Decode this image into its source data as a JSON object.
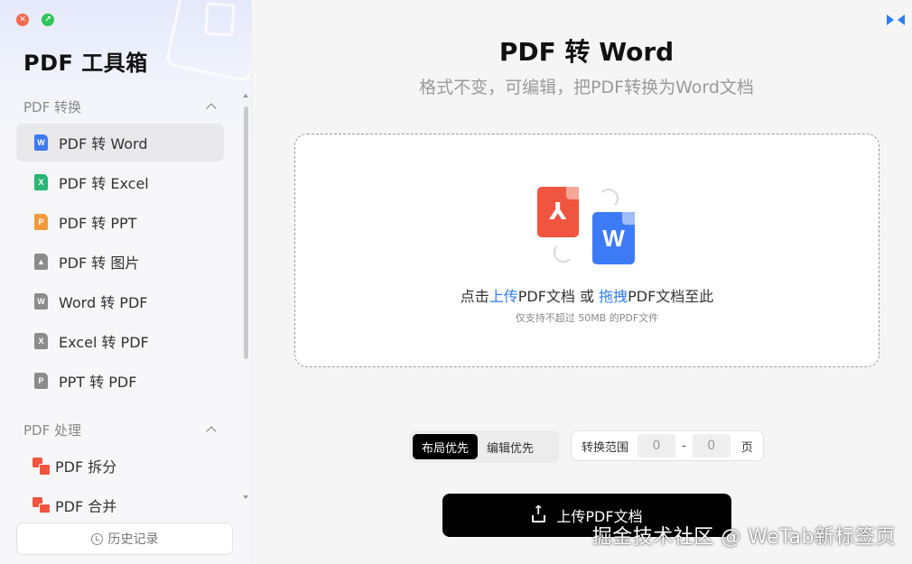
{
  "app": {
    "title": "PDF 工具箱"
  },
  "window": {
    "close_glyph": "✕",
    "max_glyph": "↗"
  },
  "sidebar": {
    "groups": [
      {
        "title": "PDF 转换",
        "items": [
          {
            "label": "PDF 转 Word",
            "icon": "word-file-icon",
            "glyph": "W",
            "active": true
          },
          {
            "label": "PDF 转 Excel",
            "icon": "excel-file-icon",
            "glyph": "X"
          },
          {
            "label": "PDF 转 PPT",
            "icon": "ppt-file-icon",
            "glyph": "P"
          },
          {
            "label": "PDF 转 图片",
            "icon": "image-file-icon",
            "glyph": "▲"
          },
          {
            "label": "Word 转 PDF",
            "icon": "word-file-icon",
            "glyph": "W"
          },
          {
            "label": "Excel 转 PDF",
            "icon": "excel-file-icon",
            "glyph": "X"
          },
          {
            "label": "PPT 转 PDF",
            "icon": "ppt-file-icon",
            "glyph": "P"
          }
        ]
      },
      {
        "title": "PDF 处理",
        "items": [
          {
            "label": "PDF 拆分",
            "icon": "pdf-split-icon"
          },
          {
            "label": "PDF 合并",
            "icon": "pdf-merge-icon"
          }
        ]
      }
    ],
    "history_label": "历史记录"
  },
  "main": {
    "title": "PDF 转 Word",
    "subtitle": "格式不变，可编辑，把PDF转换为Word文档",
    "dropzone": {
      "text_prefix": "点击",
      "upload_link": "上传",
      "text_mid": "PDF文档 或 ",
      "drag_link": "拖拽",
      "text_suffix": "PDF文档至此",
      "hint": "仅支持不超过 50MB 的PDF文件",
      "pdf_glyph": "⅄",
      "word_glyph": "W"
    },
    "mode": {
      "options": [
        "布局优先",
        "编辑优先"
      ],
      "selected": "布局优先"
    },
    "range": {
      "label": "转换范围",
      "from": "0",
      "to": "0",
      "separator": "-",
      "unit": "页"
    },
    "upload_button": "上传PDF文档"
  },
  "watermark": "掘金技术社区 @ WeTab新标签页",
  "colors": {
    "accent": "#2f7cf6",
    "pdf_red": "#f0553f",
    "word_blue": "#3d7bf6",
    "excel_green": "#2bb673",
    "ppt_orange": "#f39a3d"
  }
}
